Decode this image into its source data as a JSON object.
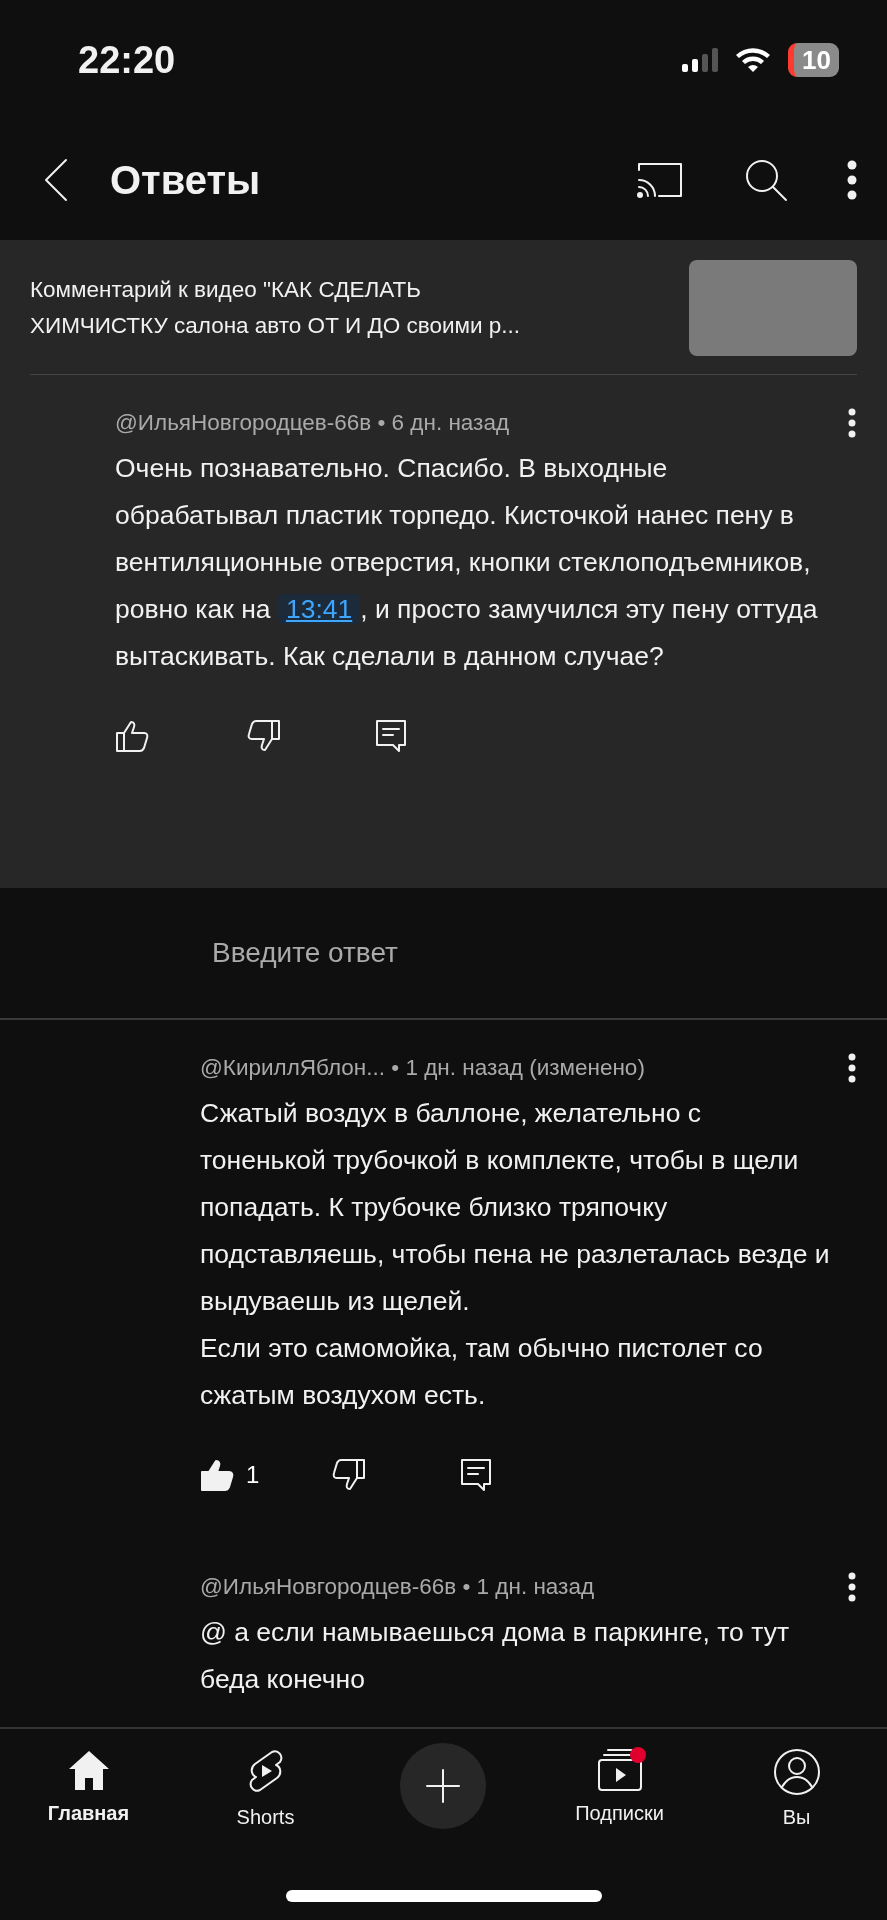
{
  "status_bar": {
    "time": "22:20",
    "battery": "10"
  },
  "header": {
    "title": "Ответы"
  },
  "video_ref": {
    "lines": [
      "Комментарий к видео \"КАК СДЕЛАТЬ",
      "ХИМЧИСТКУ салона авто ОТ И ДО своими р..."
    ]
  },
  "comments": [
    {
      "kind": "parent",
      "author": "@ИльяНовгородцев-66в",
      "separator": "•",
      "time": "6 дн. назад",
      "body": [
        {
          "kind": "text",
          "text": "Очень познавательно. Спасибо. В выходные обрабатывал пластик торпедо. Кисточкой нанес пену в вентиляционные отверстия, кнопки стеклоподъемников, ровно как на "
        },
        {
          "kind": "timestamp",
          "text": "13:41"
        },
        {
          "kind": "text",
          "text": ", и просто замучился эту пену оттуда вытаскивать. Как сделали в данном случае?"
        }
      ],
      "liked": false
    },
    {
      "kind": "reply",
      "author": "@КириллЯблон...",
      "separator": "•",
      "time": "1 дн. назад (изменено)",
      "body": [
        {
          "kind": "text",
          "text": "Сжатый воздух в баллоне, желательно с тоненькой трубочкой в комплекте, чтобы в щели попадать. К трубочке близко тряпочку подставляешь, чтобы пена не разлеталась везде и выдуваешь из щелей.\nЕсли это самомойка, там обычно пистолет со сжатым воздухом есть."
        }
      ],
      "liked": true,
      "likes": "1"
    },
    {
      "kind": "reply",
      "author": "@ИльяНовгородцев-66в",
      "separator": "•",
      "time": "1 дн. назад",
      "body": [
        {
          "kind": "text",
          "text": "@ а если намываешься дома в паркинге, то тут беда конечно"
        }
      ]
    }
  ],
  "reply_field": {
    "placeholder": "Введите ответ"
  },
  "bottom_nav": [
    {
      "kind": "home",
      "label": "Главная",
      "selected": true,
      "badge": false
    },
    {
      "kind": "shorts",
      "label": "Shorts",
      "selected": false,
      "badge": false
    },
    {
      "kind": "create"
    },
    {
      "kind": "subscriptions",
      "label": "Подписки",
      "selected": false,
      "badge": true
    },
    {
      "kind": "you",
      "label": "Вы",
      "selected": false,
      "badge": false
    }
  ]
}
